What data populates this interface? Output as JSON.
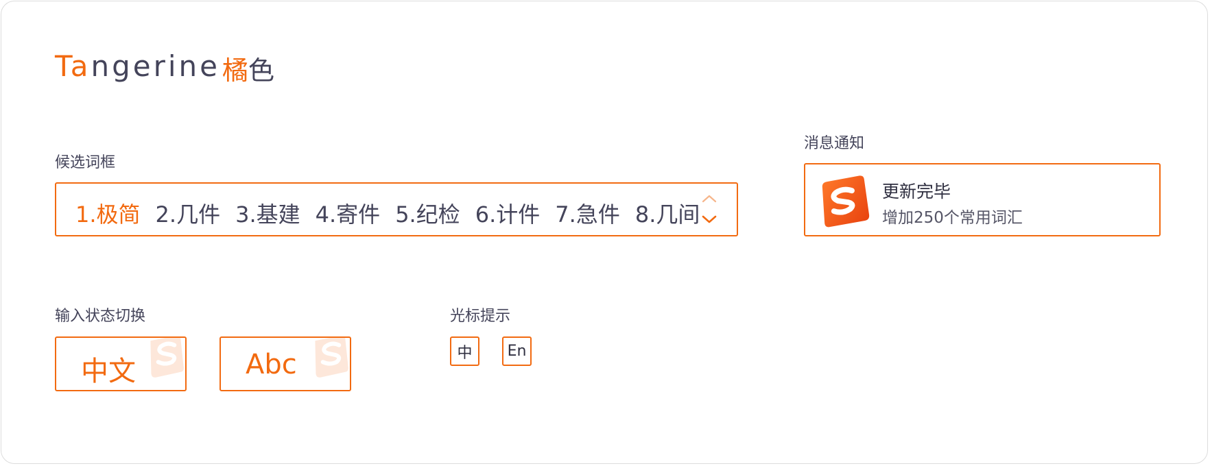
{
  "logo": {
    "prefix_accent": "Ta",
    "suffix": "ngerine",
    "zh_accent": "橘",
    "zh_rest": "色"
  },
  "candidate": {
    "label": "候选词框",
    "items": [
      "1.极简",
      "2.几件",
      "3.基建",
      "4.寄件",
      "5.纪检",
      "6.计件",
      "7.急件",
      "8.几间"
    ],
    "active_index": 0,
    "up_icon": "chevron-up-icon",
    "down_icon": "chevron-down-icon"
  },
  "notification": {
    "label": "消息通知",
    "title": "更新完毕",
    "body": "增加250个常用词汇",
    "icon": "sogou-logo-icon"
  },
  "input_mode": {
    "label": "输入状态切换",
    "chinese": "中文",
    "english": "Abc"
  },
  "cursor_hint": {
    "label": "光标提示",
    "chinese": "中",
    "english": "En"
  },
  "colors": {
    "accent": "#f26a10",
    "text": "#44445a",
    "border": "#dcdcdc"
  }
}
